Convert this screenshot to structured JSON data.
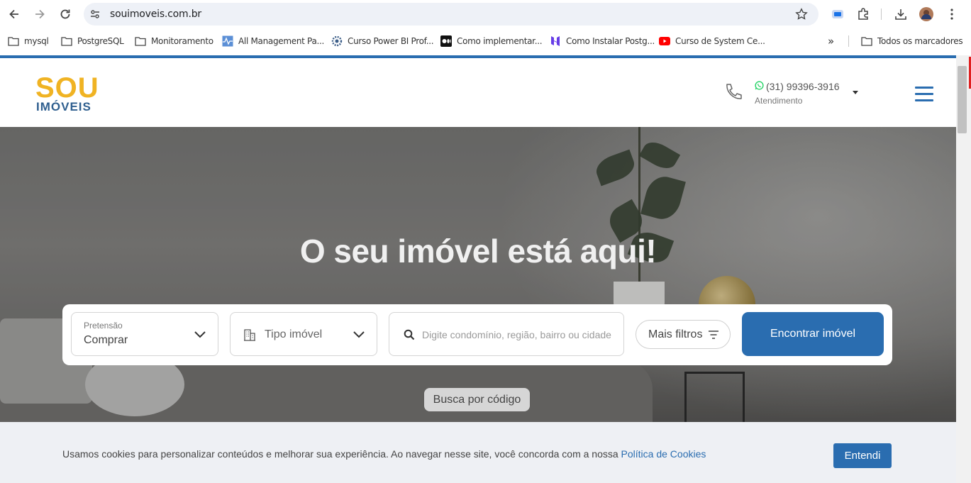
{
  "browser": {
    "url": "souimoveis.com.br",
    "bookmarks": [
      {
        "label": "mysql",
        "icon": "folder-icon"
      },
      {
        "label": "PostgreSQL",
        "icon": "folder-icon"
      },
      {
        "label": "Monitoramento",
        "icon": "folder-icon"
      },
      {
        "label": "All Management Pa...",
        "icon": "pulse-icon"
      },
      {
        "label": "Curso Power BI Prof...",
        "icon": "gear-icon"
      },
      {
        "label": "Como implementar...",
        "icon": "medium-icon"
      },
      {
        "label": "Como Instalar Postg...",
        "icon": "hostinger-icon"
      },
      {
        "label": "Curso de System Ce...",
        "icon": "youtube-icon"
      }
    ],
    "more_bookmarks_label": "»",
    "all_bookmarks": "Todos os marcadores",
    "colors": {
      "youtube": "#ff0000",
      "hostinger": "#673de6"
    }
  },
  "header": {
    "logo_top": "SOU",
    "logo_bottom": "IMÓVEIS",
    "phone": "(31) 99396-3916",
    "phone_label": "Atendimento",
    "colors": {
      "brand_yellow": "#f0b323",
      "brand_blue": "#2a6db0",
      "whatsapp": "#25d366"
    }
  },
  "hero": {
    "title": "O seu imóvel está aqui!",
    "search": {
      "pretensao_label": "Pretensão",
      "pretensao_value": "Comprar",
      "tipo_placeholder": "Tipo imóvel",
      "search_placeholder": "Digite condomínio, região, bairro ou cidade",
      "filters_label": "Mais filtros",
      "submit_label": "Encontrar imóvel"
    },
    "code_search_label": "Busca por código"
  },
  "cookie": {
    "message": "Usamos cookies para personalizar conteúdos e melhorar sua experiência. Ao navegar nesse site, você concorda com a nossa",
    "link": "Política de Cookies",
    "accept": "Entendi"
  }
}
